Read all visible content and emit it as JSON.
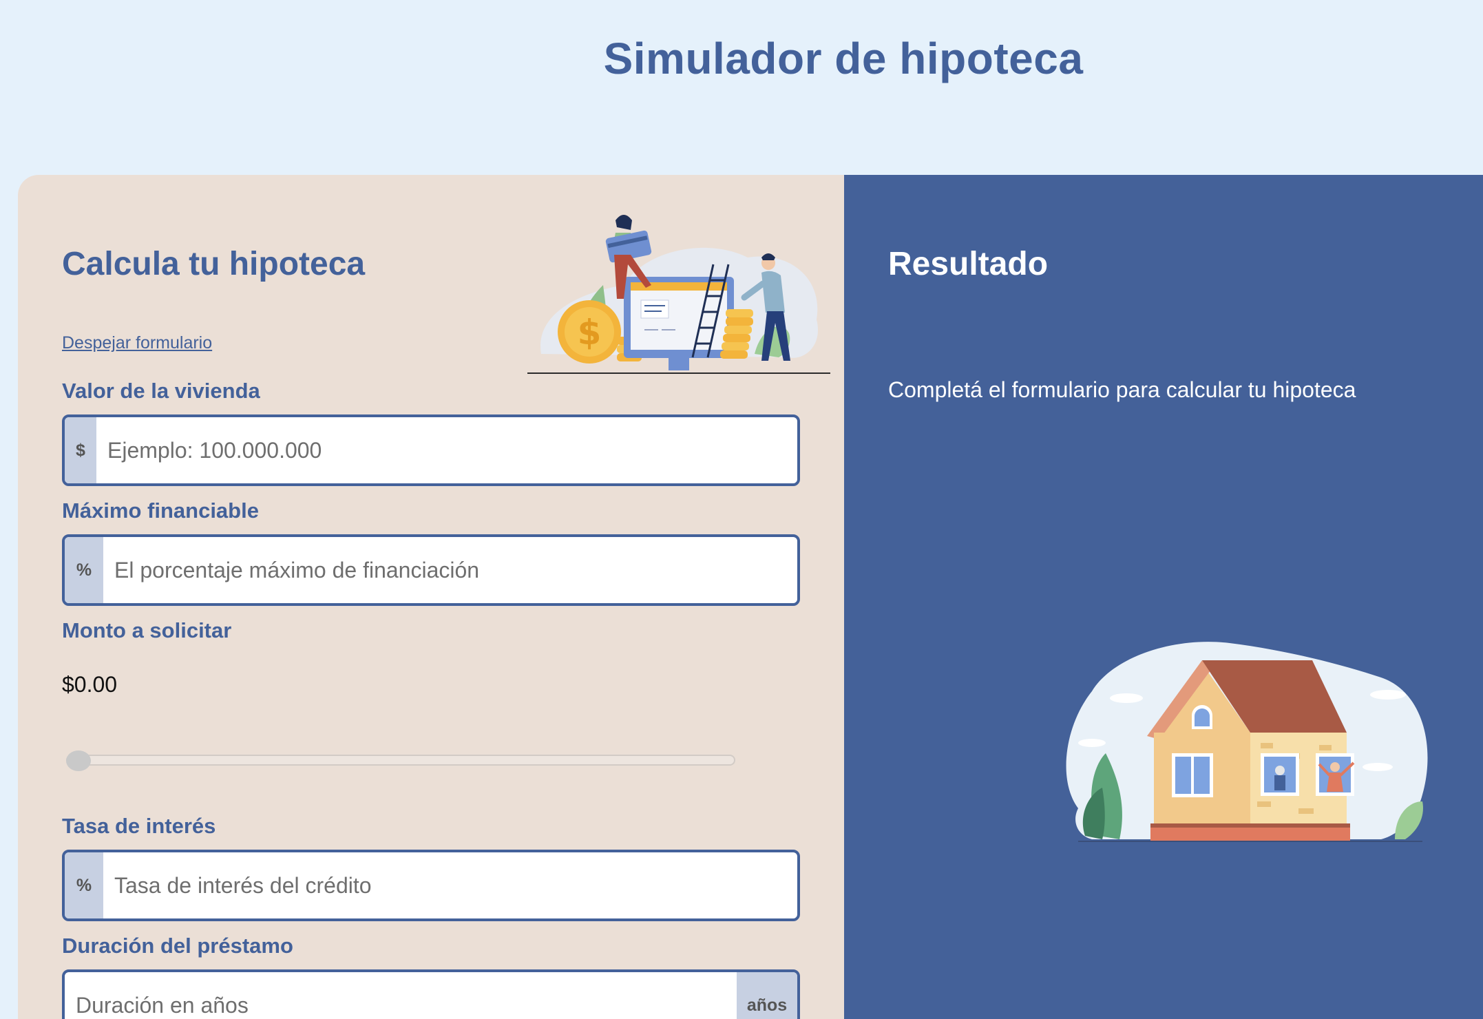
{
  "page": {
    "title": "Simulador de hipoteca"
  },
  "form": {
    "title": "Calcula tu hipoteca",
    "clear_link": "Despejar formulario",
    "fields": {
      "home_value": {
        "label": "Valor de la vivienda",
        "prefix": "$",
        "placeholder": "Ejemplo: 100.000.000",
        "value": ""
      },
      "max_financing": {
        "label": "Máximo financiable",
        "prefix": "%",
        "placeholder": "El porcentaje máximo de financiación",
        "value": ""
      },
      "loan_amount": {
        "label": "Monto a solicitar",
        "value": "$0.00",
        "slider_fraction": 0
      },
      "interest_rate": {
        "label": "Tasa de interés",
        "prefix": "%",
        "placeholder": "Tasa de interés del crédito",
        "value": ""
      },
      "duration": {
        "label": "Duración del préstamo",
        "suffix": "años",
        "placeholder": "Duración en años",
        "value": ""
      }
    }
  },
  "result": {
    "title": "Resultado",
    "message": "Completá el formulario para calcular tu hipoteca"
  },
  "colors": {
    "page_bg": "#e5f1fb",
    "primary": "#43619a",
    "form_bg": "#ebdfd6",
    "result_bg": "#446199",
    "addon_bg": "#c7d0e2"
  },
  "icons": {
    "hero": "finance-illustration",
    "result": "house-illustration"
  }
}
